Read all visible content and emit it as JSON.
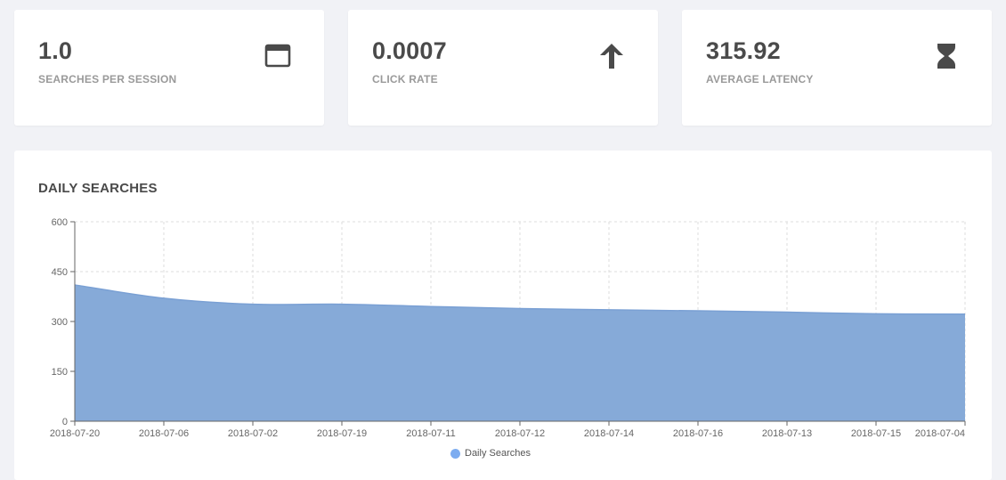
{
  "stats": [
    {
      "value": "1.0",
      "label": "SEARCHES PER SESSION",
      "icon": "window-icon"
    },
    {
      "value": "0.0007",
      "label": "CLICK RATE",
      "icon": "arrow-up-icon"
    },
    {
      "value": "315.92",
      "label": "AVERAGE LATENCY",
      "icon": "hourglass-icon"
    }
  ],
  "colors": {
    "background": "#f1f2f6",
    "card": "#ffffff",
    "area_fill": "#86aad8",
    "area_line": "#7aa0d4",
    "legend_dot": "#7cacf0",
    "icon": "#4a4a4a"
  },
  "chart_data": {
    "type": "area",
    "title": "DAILY SEARCHES",
    "categories": [
      "2018-07-20",
      "2018-07-06",
      "2018-07-02",
      "2018-07-19",
      "2018-07-11",
      "2018-07-12",
      "2018-07-14",
      "2018-07-16",
      "2018-07-13",
      "2018-07-15",
      "2018-07-04"
    ],
    "series": [
      {
        "name": "Daily Searches",
        "values": [
          410,
          370,
          352,
          352,
          345,
          339,
          335,
          332,
          328,
          323,
          322
        ]
      }
    ],
    "ylim": [
      0,
      600
    ],
    "yticks": [
      0,
      150,
      300,
      450,
      600
    ],
    "grid": true,
    "legend": "bottom-center"
  }
}
